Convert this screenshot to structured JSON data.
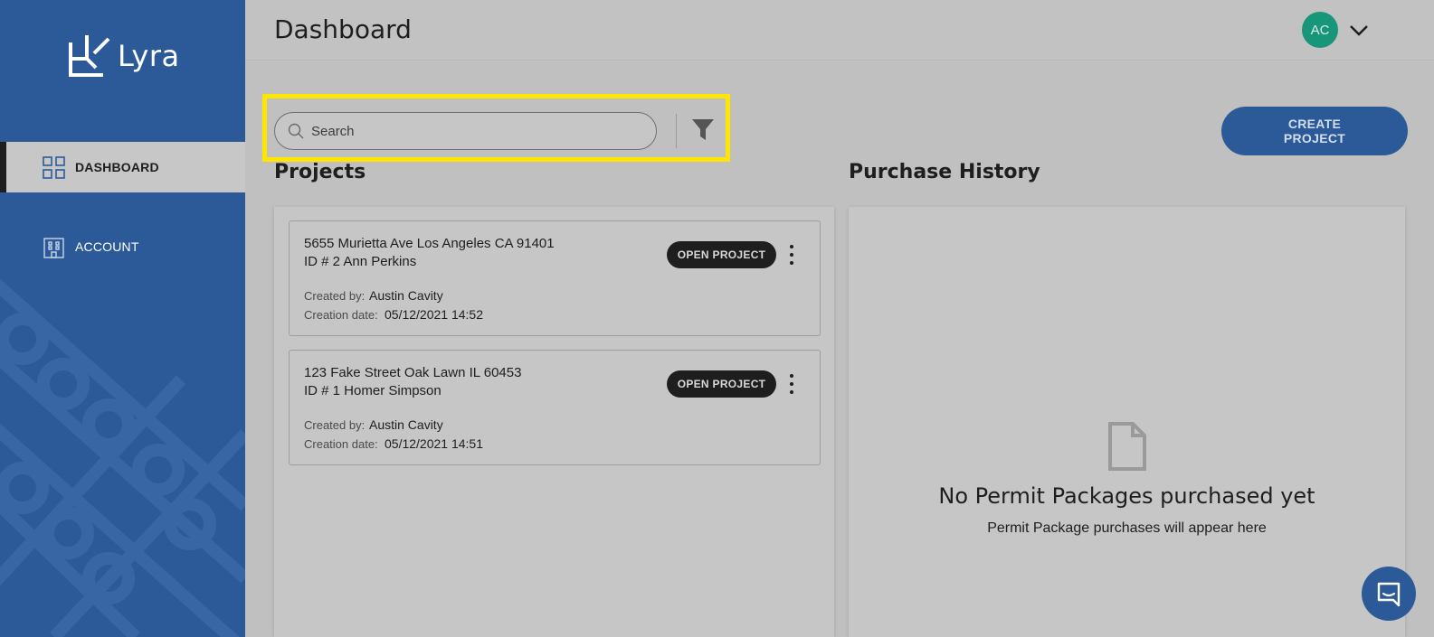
{
  "app": {
    "name": "Lyra"
  },
  "sidebar": {
    "items": [
      {
        "label": "DASHBOARD",
        "icon": "grid-icon",
        "active": true
      },
      {
        "label": "ACCOUNT",
        "icon": "building-icon",
        "active": false
      }
    ]
  },
  "header": {
    "title": "Dashboard",
    "avatar_initials": "AC",
    "avatar_color": "#18967a"
  },
  "search": {
    "placeholder": "Search",
    "value": ""
  },
  "toolbar": {
    "create_label": "CREATE PROJECT"
  },
  "projects": {
    "title": "Projects",
    "created_by_label": "Created by:",
    "creation_date_label": "Creation date:",
    "open_label": "OPEN PROJECT",
    "items": [
      {
        "address": "5655 Murietta Ave Los Angeles CA 91401",
        "id_line": "ID # 2 Ann Perkins",
        "created_by": "Austin Cavity",
        "creation_date": "05/12/2021 14:52"
      },
      {
        "address": "123 Fake Street Oak Lawn IL 60453",
        "id_line": "ID # 1 Homer Simpson",
        "created_by": "Austin Cavity",
        "creation_date": "05/12/2021 14:51"
      }
    ]
  },
  "purchase_history": {
    "title": "Purchase History",
    "empty_title": "No Permit Packages purchased yet",
    "empty_subtitle": "Permit Package purchases will appear here"
  },
  "colors": {
    "brand": "#2c5a98",
    "highlight": "#ffe600",
    "dark": "#1e1e1e"
  }
}
